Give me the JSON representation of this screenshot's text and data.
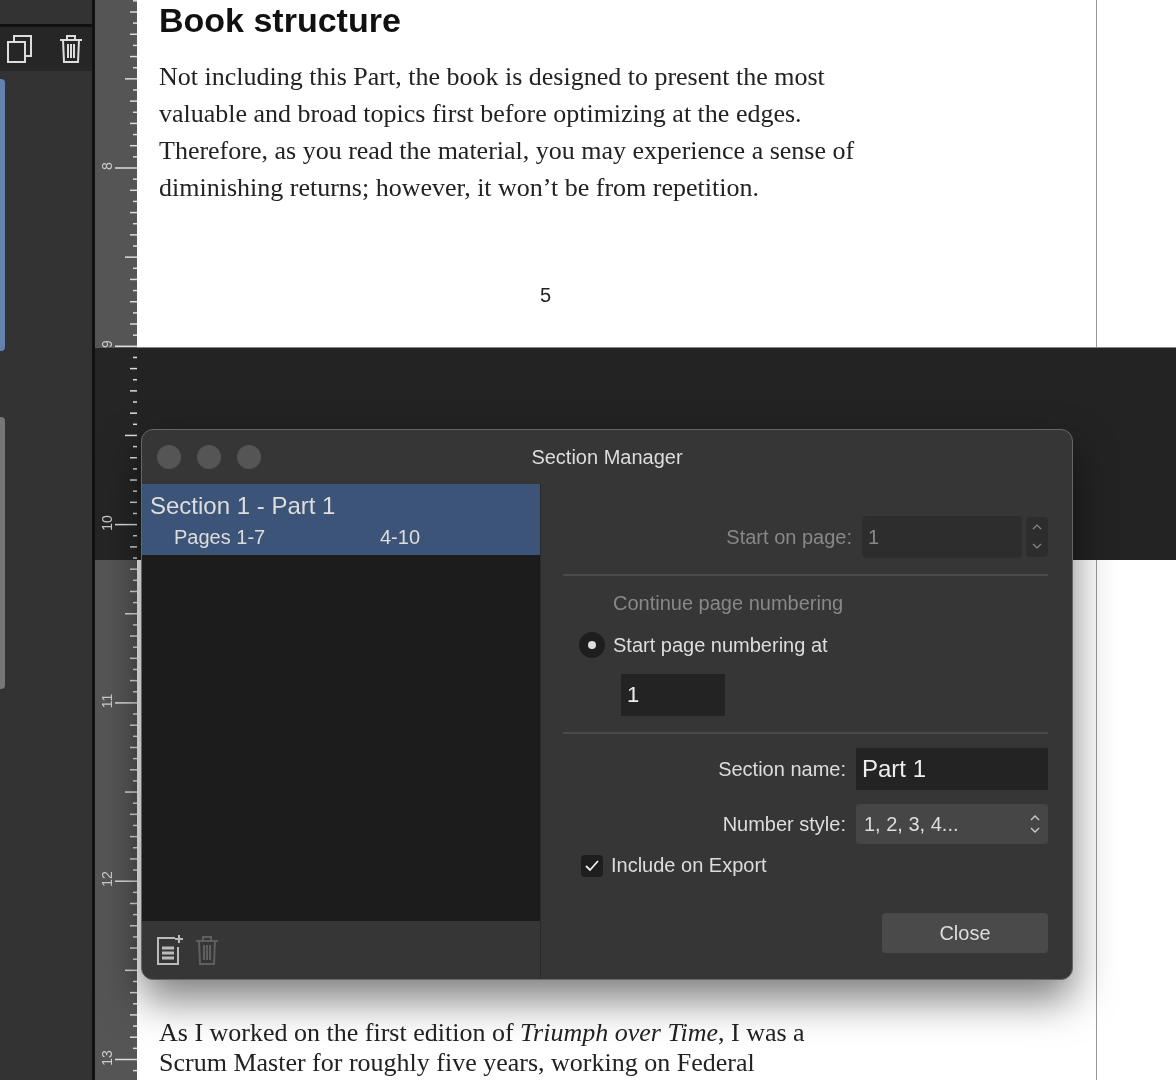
{
  "side_panel": {
    "toolbar": [
      {
        "kind": "duplicate"
      },
      {
        "kind": "delete"
      }
    ],
    "thumbnails": [
      {
        "selected": true
      },
      {
        "selected": false
      }
    ]
  },
  "ruler": {
    "marks": [
      "8",
      "9",
      "10",
      "11",
      "12",
      "13"
    ]
  },
  "pages": [
    {
      "heading": "Book structure",
      "paragraph": "Not including this Part, the book is designed to present the most valuable and broad topics first before optimizing at the edges. Therefore, as you read the material, you may experience a sense of diminishing returns; however, it won’t be from repetition.",
      "page_number": "5"
    },
    {
      "paragraph": "As I worked on the first edition of *Triumph over Time*, I was a Scrum Master for roughly five years, working on Federal"
    }
  ],
  "dialog": {
    "title": "Section Manager",
    "sections": [
      {
        "name": "Section 1 - Part 1",
        "pages": "Pages 1-7",
        "range": "4-10",
        "selected": true
      }
    ],
    "list_tools": [
      {
        "kind": "add",
        "disabled": false
      },
      {
        "kind": "delete",
        "disabled": true
      }
    ],
    "start_on_page": {
      "label": "Start on page:",
      "value": "1",
      "disabled": true
    },
    "numbering": [
      {
        "label": "Continue page numbering",
        "selected": false,
        "disabled": true
      },
      {
        "label": "Start page numbering at",
        "selected": true,
        "disabled": false
      }
    ],
    "start_at": {
      "value": "1"
    },
    "section_name": {
      "label": "Section name:",
      "value": "Part 1"
    },
    "number_style": {
      "label": "Number style:",
      "value": "1, 2, 3, 4..."
    },
    "include_on_export": {
      "label": "Include on Export",
      "checked": true
    },
    "close_button": "Close"
  }
}
